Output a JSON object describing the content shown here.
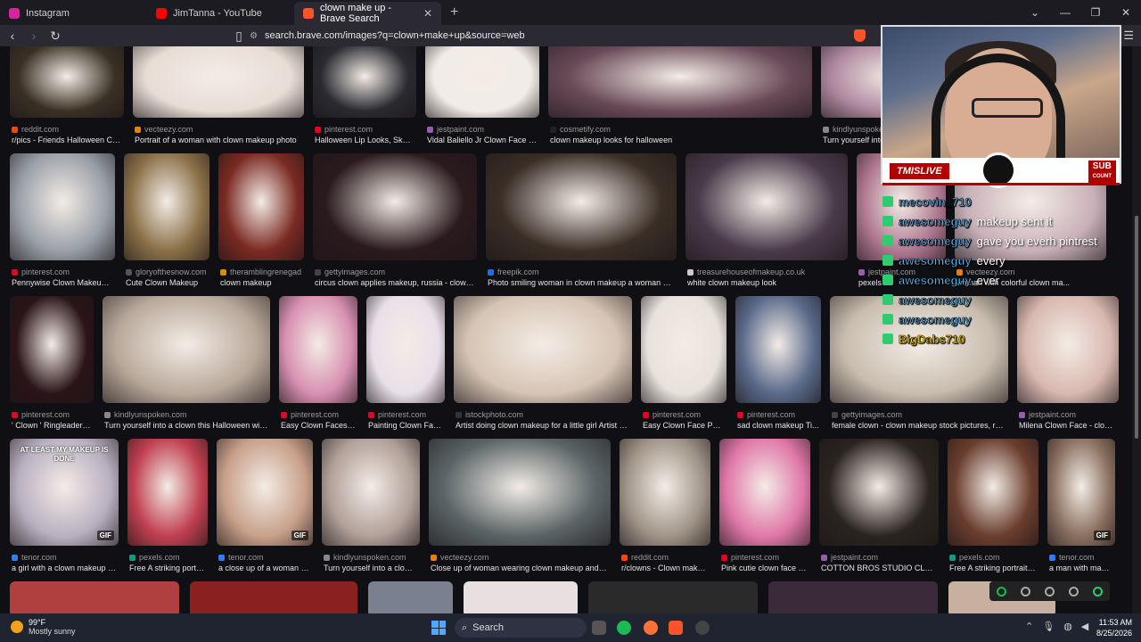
{
  "tabs": [
    {
      "title": "Instagram",
      "color": "#d6249f"
    },
    {
      "title": "JimTanna - YouTube",
      "color": "#ff0000"
    },
    {
      "title": "clown make up - Brave Search",
      "color": "#fb542b"
    }
  ],
  "address": {
    "url": "search.brave.com/images?q=clown+make+up&source=web"
  },
  "rows": [
    [
      {
        "source": "reddit.com",
        "caption": "r/pics - Friends Halloween Clo...",
        "color": "#3a3024",
        "dot": "#ff4500"
      },
      {
        "source": "vecteezy.com",
        "caption": "Portrait of a woman with clown makeup photo",
        "color": "#e8ddd5",
        "dot": "#f07d00"
      },
      {
        "source": "pinterest.com",
        "caption": "Halloween Lip Looks, Skele...",
        "color": "#2a2a30",
        "dot": "#e60023"
      },
      {
        "source": "jestpaint.com",
        "caption": "Vidal Baliello Jr Clown Face clo...",
        "color": "#f2ece8",
        "dot": "#9b59b6"
      },
      {
        "source": "cosmetify.com",
        "caption": "clown makeup looks for halloween",
        "color": "#6a4a58",
        "dot": "#222222"
      },
      {
        "source": "kindlyunspoken.com",
        "caption": "Turn yourself into a clown",
        "color": "#b08aa0",
        "dot": "#888888"
      }
    ],
    [
      {
        "source": "pinterest.com",
        "caption": "Pennywise Clown Makeup, P...",
        "color": "#9aa0a8",
        "dot": "#e60023"
      },
      {
        "source": "gloryofthesnow.com",
        "caption": "Cute Clown Makeup",
        "color": "#8a7048",
        "dot": "#555555"
      },
      {
        "source": "theramblingrenegad...",
        "caption": "clown makeup",
        "color": "#7a2a22",
        "dot": "#e08a00"
      },
      {
        "source": "gettyimages.com",
        "caption": "circus clown applies makeup, russia - clown ...",
        "color": "#2a1a1e",
        "dot": "#444444"
      },
      {
        "source": "freepik.com",
        "caption": "Photo smiling woman in clown makeup a woman with ...",
        "color": "#3a2e26",
        "dot": "#1273eb"
      },
      {
        "source": "treasurehouseofmakeup.co.uk",
        "caption": "white clown makeup look",
        "color": "#4a3a4a",
        "dot": "#cccccc"
      },
      {
        "source": "jestpaint.com",
        "caption": "pexels",
        "color": "#b07890",
        "dot": "#9b59b6"
      },
      {
        "source": "vecteezy.com",
        "caption": "woman with colorful clown ma...",
        "color": "#c8b0b8",
        "dot": "#f07d00"
      }
    ],
    [
      {
        "source": "pinterest.com",
        "caption": "' Clown ' Ringleader M...",
        "color": "#2a1418",
        "dot": "#e60023"
      },
      {
        "source": "kindlyunspoken.com",
        "caption": "Turn yourself into a clown this Halloween with ...",
        "color": "#b8a89a",
        "dot": "#888888"
      },
      {
        "source": "pinterest.com",
        "caption": "Easy Clown Faces, S...",
        "color": "#d890b0",
        "dot": "#e60023"
      },
      {
        "source": "pinterest.com",
        "caption": "Painting Clown Face...",
        "color": "#e8e0e8",
        "dot": "#e60023"
      },
      {
        "source": "istockphoto.com",
        "caption": "Artist doing clown makeup for a little girl Artist pai...",
        "color": "#d6c4b4",
        "dot": "#333333"
      },
      {
        "source": "pinterest.com",
        "caption": "Easy Clown Face Paint...",
        "color": "#e8e2dc",
        "dot": "#e60023"
      },
      {
        "source": "pinterest.com",
        "caption": "sad clown makeup Ti...",
        "color": "#5a6a8a",
        "dot": "#e60023"
      },
      {
        "source": "gettyimages.com",
        "caption": "female clown - clown makeup stock pictures, roya...",
        "color": "#c8bcae",
        "dot": "#444444"
      },
      {
        "source": "jestpaint.com",
        "caption": "Milena Clown Face - clown...",
        "color": "#d8b8b0",
        "dot": "#9b59b6"
      }
    ],
    [
      {
        "source": "tenor.com",
        "caption": "a girl with a clown makeup on...",
        "color": "#b8b0c0",
        "dot": "#2a7fff",
        "gif": "GIF",
        "overlay": "AT LEAST MY MAKEUP IS DONE"
      },
      {
        "source": "pexels.com",
        "caption": "Free A striking portra...",
        "color": "#c04050",
        "dot": "#05a081"
      },
      {
        "source": "tenor.com",
        "caption": "a close up of a woman ap...",
        "color": "#c8a08a",
        "dot": "#2a7fff",
        "gif": "GIF"
      },
      {
        "source": "kindlyunspoken.com",
        "caption": "Turn yourself into a clown ...",
        "color": "#b0a098",
        "dot": "#888888"
      },
      {
        "source": "vecteezy.com",
        "caption": "Close up of woman wearing clown makeup and hat...",
        "color": "#5a6466",
        "dot": "#f07d00"
      },
      {
        "source": "reddit.com",
        "caption": "r/clowns - Clown makeu...",
        "color": "#a09488",
        "dot": "#ff4500"
      },
      {
        "source": "pinterest.com",
        "caption": "Pink cutie clown face p...",
        "color": "#e078a8",
        "dot": "#e60023"
      },
      {
        "source": "jestpaint.com",
        "caption": "COTTON BROS STUDIO CLOWN ...",
        "color": "#2a2420",
        "dot": "#9b59b6"
      },
      {
        "source": "pexels.com",
        "caption": "Free A striking portrait o...",
        "color": "#6a3e2e",
        "dot": "#05a081"
      },
      {
        "source": "tenor.com",
        "caption": "a man with make...",
        "color": "#8a7060",
        "dot": "#2a7fff",
        "gif": "GIF"
      }
    ]
  ],
  "bottom_colors": [
    "#b04040",
    "#8a2020",
    "#7a8090",
    "#e8e0e0",
    "#2a2a2a",
    "#3a2a3a",
    "#c8b0a0"
  ],
  "stream": {
    "logo": "TMISLIVE",
    "sub_line1": "SUB",
    "sub_line2": "COUNT",
    "chat": [
      {
        "user": "mecovin_710",
        "msg": ""
      },
      {
        "user": "awesomeguy",
        "msg": "makeup sent it"
      },
      {
        "user": "awesomeguy",
        "msg": "gave you everh pintrest"
      },
      {
        "user": "awesomeguy",
        "msg": "every"
      },
      {
        "user": "awesomeguy",
        "msg": "ever"
      },
      {
        "user": "awesomeguy",
        "msg": ""
      },
      {
        "user": "awesomeguy",
        "msg": ""
      },
      {
        "user": "BigDabs710",
        "msg": ""
      }
    ]
  },
  "taskbar": {
    "weather_temp": "99°F",
    "weather_desc": "Mostly sunny",
    "search_label": "Search",
    "time": "11:53 AM",
    "date": "8/25/2026"
  }
}
